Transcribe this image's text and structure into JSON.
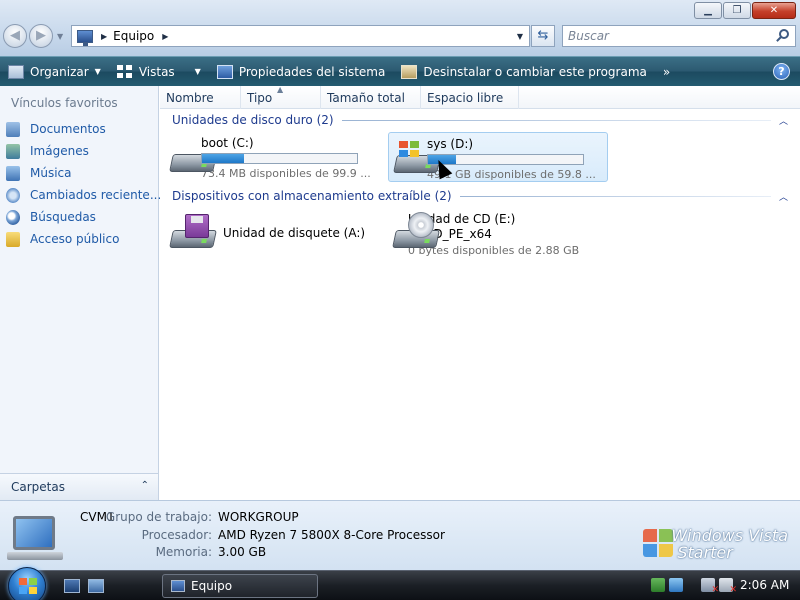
{
  "window": {
    "minimize_glyph": "▁",
    "maximize_glyph": "❐",
    "close_glyph": "✕"
  },
  "navigation": {
    "back_glyph": "◀",
    "forward_glyph": "▶",
    "dropdown_glyph": "▼"
  },
  "address": {
    "path": "Equipo",
    "refresh_glyph": "⇆"
  },
  "search": {
    "placeholder": "Buscar"
  },
  "toolbar": {
    "organize": "Organizar",
    "views": "Vistas",
    "properties": "Propiedades del sistema",
    "uninstall": "Desinstalar o cambiar este programa",
    "more": "»",
    "help": "?"
  },
  "sidebar": {
    "heading": "Vínculos favoritos",
    "items": [
      {
        "label": "Documentos",
        "icon": "documents-icon"
      },
      {
        "label": "Imágenes",
        "icon": "pictures-icon"
      },
      {
        "label": "Música",
        "icon": "music-icon"
      },
      {
        "label": "Cambiados reciente...",
        "icon": "recent-icon"
      },
      {
        "label": "Búsquedas",
        "icon": "searches-icon"
      },
      {
        "label": "Acceso público",
        "icon": "public-folder-icon"
      }
    ],
    "folders_label": "Carpetas",
    "folders_chevron": "⌃"
  },
  "columns": [
    "Nombre",
    "Tipo",
    "Tamaño total",
    "Espacio libre"
  ],
  "groups": {
    "hdd": {
      "title": "Unidades de disco duro (2)",
      "drives": [
        {
          "name": "boot (C:)",
          "free": "73.4 MB disponibles de 99.9 ...",
          "used_fraction": 0.27
        },
        {
          "name": "sys (D:)",
          "free": "49.1 GB disponibles de 59.8 ...",
          "used_fraction": 0.18
        }
      ]
    },
    "removable": {
      "title": "Dispositivos con almacenamiento extraíble (2)",
      "devices": [
        {
          "name": "Unidad de disquete (A:)"
        },
        {
          "name": "Unidad de CD (E:)",
          "label": "HBCD_PE_x64",
          "free": "0 bytes disponibles de 2.88 GB"
        }
      ]
    }
  },
  "details": {
    "computer_name": "CVM1",
    "rows": [
      {
        "label": "Grupo de trabajo:",
        "value": "WORKGROUP"
      },
      {
        "label": "Procesador:",
        "value": "AMD Ryzen 7 5800X 8-Core Processor"
      },
      {
        "label": "Memoria:",
        "value": "3.00 GB"
      }
    ],
    "brand_line1": "Windows Vista",
    "brand_line2": "Starter"
  },
  "taskbar": {
    "task_label": "Equipo",
    "clock": "2:06 AM"
  },
  "colors": {
    "accent": "#1e78c8",
    "command_bar": "#2c5a71",
    "link": "#1f5aa7"
  }
}
